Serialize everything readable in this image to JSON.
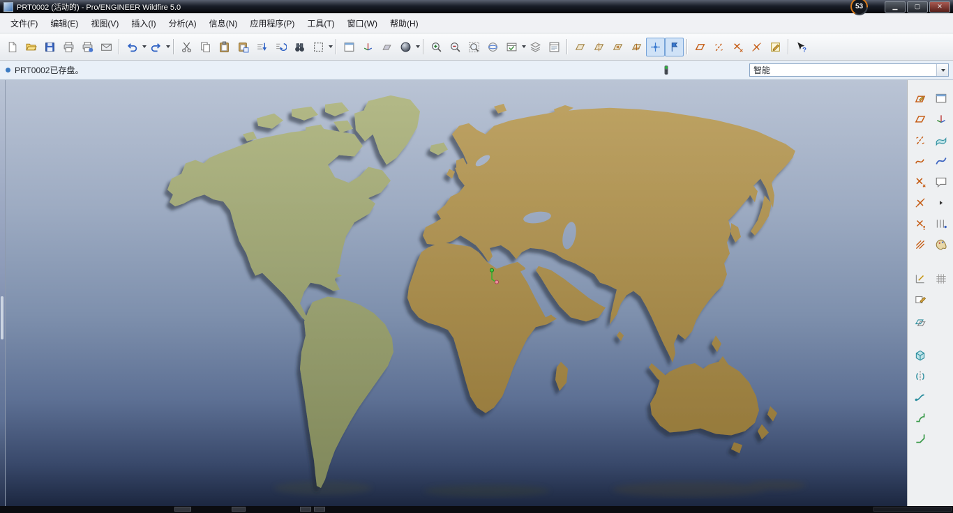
{
  "window": {
    "title": "PRT0002 (活动的) - Pro/ENGINEER Wildfire 5.0",
    "gauge_value": "53",
    "controls": [
      "minimize",
      "maximize",
      "close"
    ]
  },
  "menubar": {
    "items": [
      "文件(F)",
      "编辑(E)",
      "视图(V)",
      "插入(I)",
      "分析(A)",
      "信息(N)",
      "应用程序(P)",
      "工具(T)",
      "窗口(W)",
      "帮助(H)"
    ]
  },
  "toolbar": {
    "icons": [
      "new-file",
      "open-file",
      "save",
      "print",
      "print-setup",
      "send-mail",
      "undo",
      "redo",
      "cut",
      "copy",
      "paste",
      "paste-special",
      "regenerate",
      "regenerate-manager",
      "find",
      "select-region",
      "model-window",
      "drag-3d",
      "component-display",
      "render-style",
      "zoom-in",
      "zoom-out",
      "refit",
      "reorient",
      "saved-views",
      "layers",
      "view-manager",
      "datum-plane-display",
      "datum-axis-display",
      "datum-point-display",
      "datum-csys-display",
      "spin-center-toggle",
      "annotation-display-toggle",
      "datum-plane-create",
      "datum-axis-create",
      "datum-point-create",
      "datum-csys-create",
      "sketch-create",
      "context-help"
    ]
  },
  "messagebar": {
    "message": "PRT0002已存盘。",
    "selection_filter": "智能"
  },
  "viewport": {
    "content": "3d-world-map-model",
    "colors": {
      "background_top": "#bac4d5",
      "background_bottom": "#1c2740",
      "land_west": "#9ca46f",
      "land_east": "#a9905a"
    }
  },
  "right_toolbar": {
    "col1": [
      "sketch-tool",
      "datum-plane-tool",
      "datum-axis-tool",
      "datum-curve-tool",
      "datum-point-tool",
      "coordinate-system-tool",
      "point-array-tool",
      "use-edge-tool",
      "dimension-tool",
      "modify-tool",
      "offset-tool",
      "extrude-tool",
      "revolve-tool",
      "sweep-tool",
      "round-tool",
      "chamfer-tool"
    ],
    "col2": [
      "copy-geometry-tool",
      "orient-mode-tool",
      "surface-tool",
      "style-tool",
      "annotation-tool",
      "flyout-arrow",
      "pattern-tool",
      "palette-tool",
      "grid-tool"
    ]
  }
}
